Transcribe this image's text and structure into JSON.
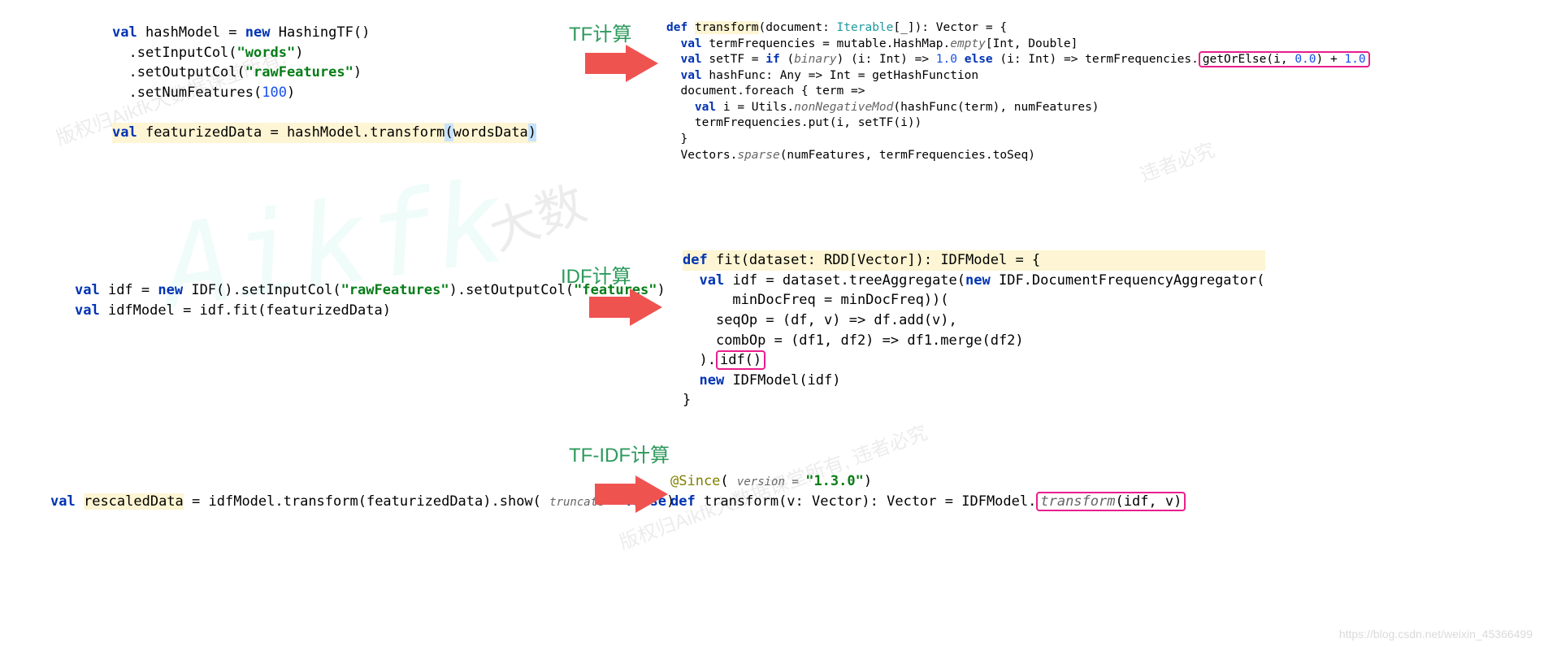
{
  "labels": {
    "tf": "TF计算",
    "idf": "IDF计算",
    "tfidf": "TF-IDF计算"
  },
  "watermarks": {
    "big": "Aikfk",
    "text1": "版权归Aikfk大数据课堂所有,",
    "text2": "大数",
    "text3": "版权归Aikfk大数据课堂所有, 违者必究",
    "text4": "违者必究"
  },
  "left_blocks": {
    "block1": {
      "l1_kw": "val",
      "l1_rest": " hashModel = ",
      "l1_new": "new",
      "l1_cls": " HashingTF()",
      "l2_pre": "  .setInputCol(",
      "l2_str": "\"words\"",
      "l2_post": ")",
      "l3_pre": "  .setOutputCol(",
      "l3_str": "\"rawFeatures\"",
      "l3_post": ")",
      "l4_pre": "  .setNumFeatures(",
      "l4_num": "100",
      "l4_post": ")",
      "l6_kw": "val",
      "l6_name": " featurizedData = hashModel.transform",
      "l6_p1": "(",
      "l6_arg": "wordsData",
      "l6_p2": ")"
    },
    "block2": {
      "l1_kw": "val",
      "l1_rest": " idf = ",
      "l1_new": "new",
      "l1_cls": " IDF().setInputCol(",
      "l1_str1": "\"rawFeatures\"",
      "l1_mid": ").setOutputCol(",
      "l1_str2": "\"features\"",
      "l1_end": ")",
      "l2_kw": "val",
      "l2_rest": " idfModel = idf.fit(featurizedData)"
    },
    "block3": {
      "l1_kw": "val",
      "l1_pre": " ",
      "l1_hl": "rescaledData",
      "l1_rest": " = idfModel.transform(featurizedData).show( ",
      "l1_param": "truncate = ",
      "l1_false": "false",
      "l1_end": ")"
    }
  },
  "right_blocks": {
    "tf": {
      "l1_def": "def",
      "l1_pre": " ",
      "l1_name": "transform",
      "l1_sig": "(document: ",
      "l1_iter": "Iterable",
      "l1_sig2": "[_]): Vector = {",
      "l2_kw": "val",
      "l2_rest": " termFrequencies = mutable.HashMap.",
      "l2_it": "empty",
      "l2_rest2": "[Int, Double]",
      "l3_kw": "val",
      "l3_rest": " setTF = ",
      "l3_if": "if",
      "l3_rest2": " (",
      "l3_bin": "binary",
      "l3_rest3": ") (i: Int) => ",
      "l3_n1": "1.0",
      "l3_else": " else ",
      "l3_rest4": "(i: Int) => termFrequencies.",
      "l3_box": "getOrElse(i, ",
      "l3_n2": "0.0",
      "l3_box2": ") + ",
      "l3_n3": "1.0",
      "l4_kw": "val",
      "l4_rest": " hashFunc: Any => Int = getHashFunction",
      "l5_rest": "document.foreach { term =>",
      "l6_kw": "val",
      "l6_rest": " i = Utils.",
      "l6_it": "nonNegativeMod",
      "l6_rest2": "(hashFunc(term), numFeatures)",
      "l7_rest": "termFrequencies.put(i, setTF(i))",
      "l8_rest": "}",
      "l9_rest": "Vectors.",
      "l9_it": "sparse",
      "l9_rest2": "(numFeatures, termFrequencies.toSeq)"
    },
    "idf": {
      "l1_def": "def",
      "l1_pre": " ",
      "l1_name": "fit",
      "l1_sig": "(dataset: RDD[Vector]): IDFModel = {",
      "l2_kw": "val",
      "l2_rest": " idf = dataset.treeAggregate(",
      "l2_new": "new",
      "l2_rest2": " IDF.DocumentFrequencyAggregator(",
      "l3_rest": "    minDocFreq = minDocFreq))(",
      "l4_rest": "  seqOp = (df, v) => df.add(v),",
      "l5_rest": "  combOp = (df1, df2) => df1.merge(df2)",
      "l6_pre": ").",
      "l6_box": "idf()",
      "l7_new": "new",
      "l7_rest": " IDFModel(idf)",
      "l8_rest": "}"
    },
    "tfidf": {
      "l1_anno": "@Since",
      "l1_paren": "( ",
      "l1_param": "version = ",
      "l1_str": "\"1.3.0\"",
      "l1_end": ")",
      "l2_def": "def",
      "l2_rest": " transform(v: Vector): Vector = IDFModel.",
      "l2_box": "transform",
      "l2_args": "(idf, v)"
    }
  },
  "blog_url": "https://blog.csdn.net/weixin_45366499"
}
